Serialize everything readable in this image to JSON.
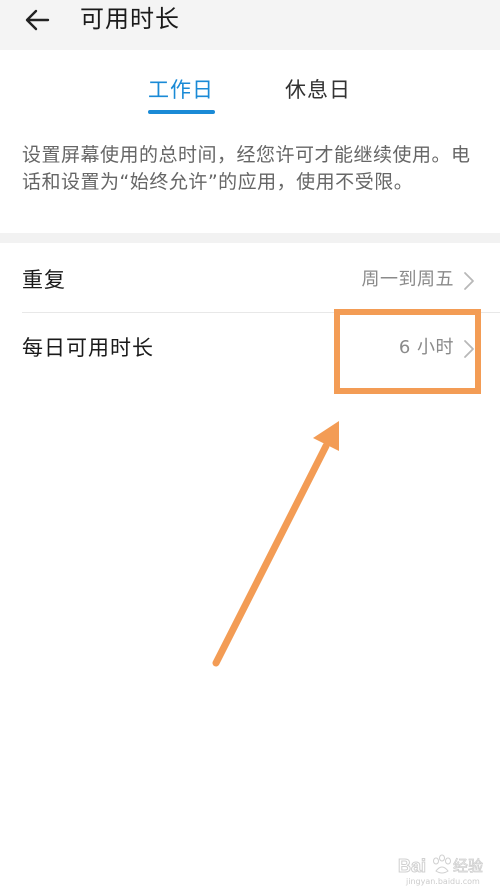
{
  "header": {
    "title": "可用时长",
    "back_icon": "arrow-left-icon"
  },
  "tabs": [
    {
      "label": "工作日",
      "selected": true
    },
    {
      "label": "休息日",
      "selected": false
    }
  ],
  "colors": {
    "accent": "#1a8ad6",
    "annotation": "#f39c55",
    "topbar": "#f4f4f4"
  },
  "description": "设置屏幕使用的总时间，经您许可才能继续使用。电话和设置为“始终允许”的应用，使用不受限。",
  "settings": [
    {
      "label": "重复",
      "value": "周一到周五",
      "icon": "chevron-right-icon"
    },
    {
      "label": "每日可用时长",
      "value": "6 小时",
      "icon": "chevron-right-icon"
    }
  ],
  "annotation": {
    "highlight_target": "每日可用时长",
    "arrow_icon": "annotation-arrow"
  },
  "watermark": {
    "brand": "Bai度经验",
    "url": "jingyan.baidu.com"
  }
}
